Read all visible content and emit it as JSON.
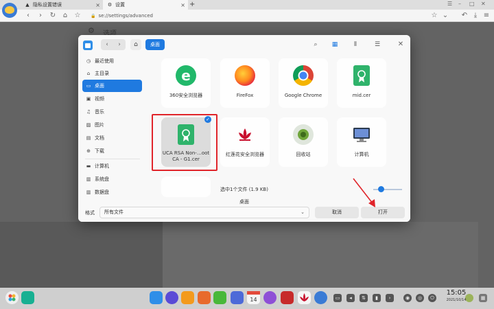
{
  "browser": {
    "tabs": [
      {
        "label": "隐私设置错误",
        "icon": "warning-icon"
      },
      {
        "label": "设置",
        "icon": "gear-icon",
        "active": true
      }
    ],
    "new_tab": "+",
    "url": "se://settings/advanced",
    "page_title": "选项"
  },
  "dialog": {
    "breadcrumb": "桌面",
    "sidebar": {
      "items": [
        {
          "label": "最近使用",
          "icon": "clock-icon"
        },
        {
          "label": "主目录",
          "icon": "home-icon"
        },
        {
          "label": "桌面",
          "icon": "desktop-icon",
          "selected": true
        },
        {
          "label": "视频",
          "icon": "video-icon"
        },
        {
          "label": "音乐",
          "icon": "music-icon"
        },
        {
          "label": "图片",
          "icon": "picture-icon"
        },
        {
          "label": "文档",
          "icon": "document-icon"
        },
        {
          "label": "下载",
          "icon": "download-icon"
        },
        {
          "label": "计算机",
          "icon": "computer-icon"
        },
        {
          "label": "系统盘",
          "icon": "disk-icon"
        },
        {
          "label": "数据盘",
          "icon": "disk-icon"
        }
      ]
    },
    "files": [
      {
        "name": "360安全浏览器",
        "icon": "browser-360-icon"
      },
      {
        "name": "FireFox",
        "icon": "firefox-icon"
      },
      {
        "name": "Google Chrome",
        "icon": "chrome-icon"
      },
      {
        "name": "mid.cer",
        "icon": "certificate-icon"
      },
      {
        "name": "UCA RSA Non-…oot CA - G1.cer",
        "icon": "certificate-icon",
        "selected": true
      },
      {
        "name": "红莲花安全浏览器",
        "icon": "lotus-browser-icon"
      },
      {
        "name": "回收站",
        "icon": "trash-icon"
      },
      {
        "name": "计算机",
        "icon": "computer-icon"
      }
    ],
    "status_text": "选中1个文件 (1.9 KB)",
    "zoom_fraction": 0.2,
    "location_label": "桌面",
    "filter_label": "格式",
    "filter_value": "所有文件",
    "cancel_label": "取消",
    "open_label": "打开"
  },
  "taskbar": {
    "time": "15:05",
    "date": "2021/10/14",
    "calendar_day": "14"
  },
  "colors": {
    "accent": "#1f7ae0",
    "highlight_red": "#e0242a"
  }
}
